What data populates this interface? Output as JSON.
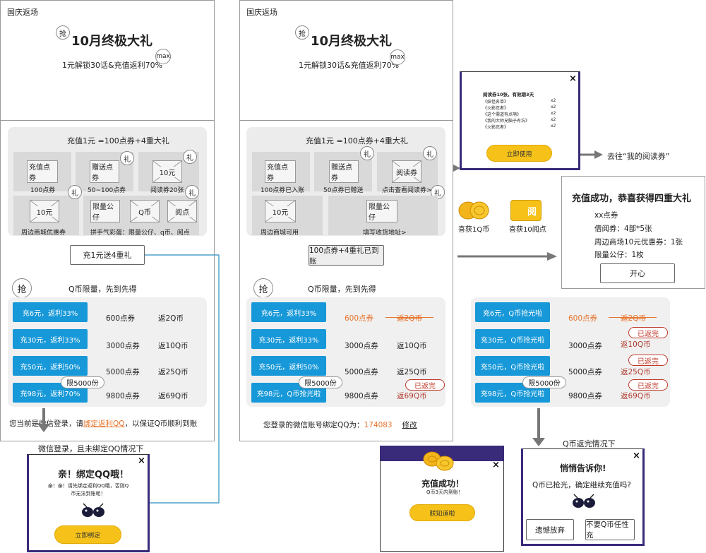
{
  "screen1": {
    "label": "国庆返场",
    "grab_icon": "抢",
    "title": "10月终极大礼",
    "subtitle": "1元解锁30话&充值返利70%",
    "max_badge": "max",
    "recharge_title": "充值1元 =100点券+4重大礼",
    "gift_badge": "礼",
    "tiles": [
      {
        "img": "充值点券",
        "caption": "100点券"
      },
      {
        "img": "赠送点券",
        "caption": "50~100点券"
      },
      {
        "img": "10元",
        "caption": "阅读券20张"
      },
      {
        "img": "10元",
        "caption": "周边商城优惠券"
      },
      {
        "img": "限量公仔",
        "img2": "Q币",
        "img3": "阅点",
        "caption": "拼手气彩蛋：限量公仔、q币、阅点"
      }
    ],
    "button": "充1元送4重礼",
    "qcoin_header": "Q币限量，先到先得",
    "rows": [
      {
        "btn": "充6元，返利33%",
        "points": "600点券",
        "rebate": "返2Q币"
      },
      {
        "btn": "充30元，返利33%",
        "points": "3000点券",
        "rebate": "返10Q币"
      },
      {
        "btn": "充50元，返利50%",
        "points": "5000点券",
        "rebate": "返25Q币"
      },
      {
        "btn": "充98元，返利70%",
        "points": "9800点券",
        "rebate": "返69Q币"
      }
    ],
    "limit_badge": "限5000份",
    "footer_pre": "您当前是微信登录，请",
    "footer_link": "绑定返利QQ",
    "footer_post": "，以保证Q币顺利到账"
  },
  "screen2": {
    "label": "国庆返场",
    "grab_icon": "抢",
    "title": "10月终极大礼",
    "subtitle": "1元解锁30话&充值返利70%",
    "max_badge": "max",
    "recharge_title": "充值1元 =100点券+4重大礼",
    "tiles": [
      {
        "img": "充值点券",
        "caption": "100点券已入账"
      },
      {
        "img": "赠送点券",
        "caption": "50点券已赠送"
      },
      {
        "img": "阅读券",
        "caption": "点击查看阅读券>"
      },
      {
        "img": "10元",
        "caption": "周边商城可用"
      },
      {
        "img": "限量公仔",
        "caption": "填写收货地址>"
      }
    ],
    "button": "100点券+4重礼已到账",
    "qcoin_header": "Q币限量，先到先得",
    "rows": [
      {
        "btn": "充6元，返利33%",
        "points": "600点券",
        "rebate": "返2Q币"
      },
      {
        "btn": "充30元，返利33%",
        "points": "3000点券",
        "rebate": "返10Q币"
      },
      {
        "btn": "充50元，返利50%",
        "points": "5000点券",
        "rebate": "返25Q币"
      },
      {
        "btn": "充98元，Q币抢光啦",
        "points": "9800点券",
        "rebate": "返69Q币"
      }
    ],
    "limit_badge": "限5000份",
    "soldout": "已返完",
    "footer_pre": "您登录的微信账号绑定QQ为：",
    "footer_qq": "174083",
    "footer_edit": "修改"
  },
  "bind_modal": {
    "caption": "微信登录，且未绑定QQ情况下",
    "title": "亲！绑定QQ哦！",
    "body": "亲！亲！请先绑定返利QQ哦，否则Q币无法到账呢！",
    "button": "立即绑定",
    "close": "×"
  },
  "voucher_modal": {
    "header": "阅读券10张，有效期3天",
    "items": [
      {
        "name": "《妖怪名单》",
        "qty": "x2"
      },
      {
        "name": "《火影忍者》",
        "qty": "x2"
      },
      {
        "name": "《这个需道有点萌》",
        "qty": "x2"
      },
      {
        "name": "《我的大师兄脑子有坑》",
        "qty": "x2"
      },
      {
        "name": "《火影忍者》",
        "qty": "x2"
      }
    ],
    "button": "立即使用",
    "close": "×",
    "arrow_label": "去往“我的阅读券”"
  },
  "rewards": {
    "qcoin": "喜获1Q币",
    "yuedian": "喜获10阅点",
    "yuedian_glyph": "阅"
  },
  "success_panel": {
    "title": "充值成功，恭喜获得四重大礼",
    "items": [
      "xx点券",
      "借阅券：4部*5张",
      "周边商场10元优惠券：1张",
      "限量公仔：1枚"
    ],
    "button": "开心"
  },
  "screen3": {
    "rows": [
      {
        "btn": "充6元，Q币抢光啦",
        "points": "600点券",
        "rebate": "返2Q币"
      },
      {
        "btn": "充30元，Q币抢光啦",
        "points": "3000点券",
        "rebate": "返10Q币"
      },
      {
        "btn": "充50元，Q币抢光啦",
        "points": "5000点券",
        "rebate": "返25Q币"
      },
      {
        "btn": "充98元，Q币抢光啦",
        "points": "9800点券",
        "rebate": "返69Q币"
      }
    ],
    "limit_badge": "限5000份",
    "soldout": "已返完",
    "caption": "Q币返完情况下"
  },
  "recharge_success_modal": {
    "title": "充值成功！",
    "subtitle": "Q币3天内到账！",
    "button": "朕知道啦",
    "close": "×"
  },
  "notice_modal": {
    "title": "悄悄告诉你!",
    "body": "Q币已抢光，确定继续充值吗?",
    "btn_left": "遗憾放弃",
    "btn_right": "不要Q币任性充",
    "close": "×"
  },
  "colors": {
    "blue": "#1798d8",
    "orange": "#e8742c",
    "darkred": "#b03a2e",
    "yellow": "#f6c21a",
    "modal_border": "#3a2a7a"
  }
}
